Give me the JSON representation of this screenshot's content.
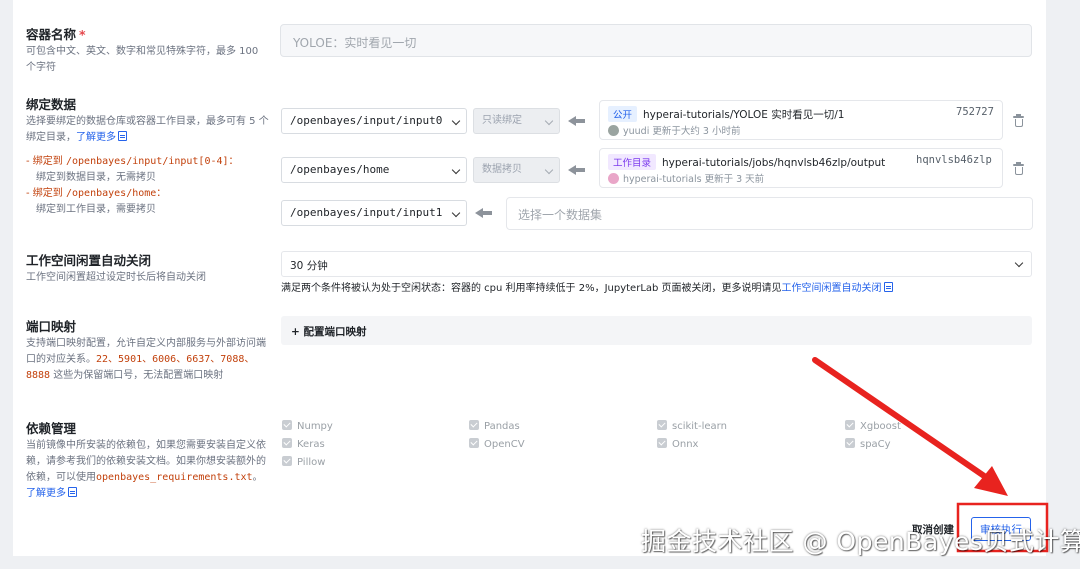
{
  "container_name": {
    "title": "容器名称",
    "required_mark": "*",
    "desc": "可包含中文、英文、数字和常见特殊字符，最多 100 个字符",
    "placeholder": "YOLOE：实时看见一切"
  },
  "bind_data": {
    "title": "绑定数据",
    "desc": "选择要绑定的数据仓库或容器工作目录，最多可有 5 个绑定目录，",
    "learn_more": "了解更多",
    "bullets": [
      {
        "prefix": "绑定到 ",
        "path": "/openbayes/input/input[0-4]",
        "suffix": "：",
        "detail": "绑定到数据目录，无需拷贝"
      },
      {
        "prefix": "绑定到 ",
        "path": "/openbayes/home",
        "suffix": "：",
        "detail": "绑定到工作目录，需要拷贝"
      }
    ],
    "rows": [
      {
        "path": "/openbayes/input/input0",
        "mode": "只读绑定"
      },
      {
        "path": "/openbayes/home",
        "mode": "数据拷贝"
      },
      {
        "path": "/openbayes/input/input1",
        "dataset_placeholder": "选择一个数据集"
      }
    ],
    "cards": [
      {
        "badge": "公开",
        "name": "hyperai-tutorials/YOLOE 实时看见一切/1",
        "id": "752727",
        "user": "yuudi",
        "updated": "更新于大约 3 小时前"
      },
      {
        "badge": "工作目录",
        "name": "hyperai-tutorials/jobs/hqnvlsb46zlp/output",
        "id": "hqnvlsb46zlp",
        "user": "hyperai-tutorials",
        "updated": "更新于 3 天前"
      }
    ]
  },
  "idle_shutdown": {
    "title": "工作空间闲置自动关闭",
    "desc": "工作空间闲置超过设定时长后将自动关闭",
    "value": "30 分钟",
    "note": "满足两个条件将被认为处于空闲状态：容器的 cpu 利用率持续低于 2%，JupyterLab 页面被关闭，更多说明请见",
    "note_link": "工作空间闲置自动关闭"
  },
  "port_mapping": {
    "title": "端口映射",
    "desc_start": "支持端口映射配置，允许自定义内部服务与外部访问端口的对应关系。",
    "ports": "22、5901、6006、6637、7088、8888",
    "desc_end": " 这些为保留端口号，无法配置端口映射",
    "button": "+ 配置端口映射"
  },
  "dependencies": {
    "title": "依赖管理",
    "desc": "当前镜像中所安装的依赖包，如果您需要安装自定义依赖，请参考我们的依赖安装文档。如果你想安装额外的依赖，可以使用",
    "file": "openbayes_requirements.txt",
    "learn_more": "了解更多",
    "packages": [
      "Numpy",
      "Pandas",
      "scikit-learn",
      "Xgboost",
      "Keras",
      "OpenCV",
      "Onnx",
      "spaCy",
      "Pillow"
    ]
  },
  "footer": {
    "cancel": "取消创建",
    "submit": "审核执行"
  },
  "watermark": "掘金技术社区 @ OpenBayes贝式计算",
  "colors": {
    "accent": "#2563eb",
    "highlight_red": "#e8231f",
    "reserved_orange": "#c2410c"
  }
}
